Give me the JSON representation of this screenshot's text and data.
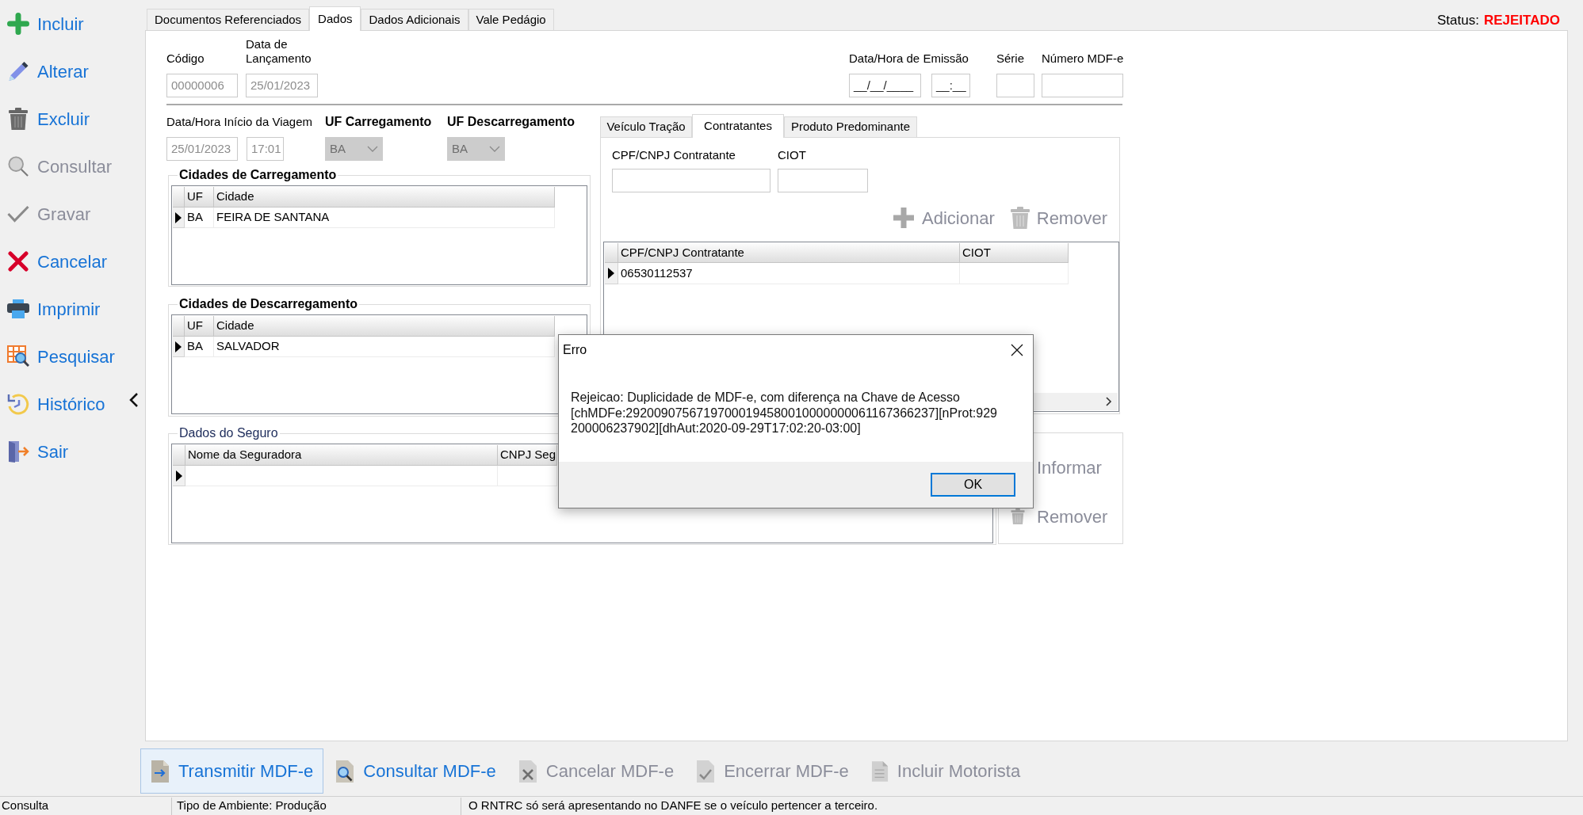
{
  "sidebar": {
    "items": [
      {
        "label": "Incluir",
        "disabled": false
      },
      {
        "label": "Alterar",
        "disabled": false
      },
      {
        "label": "Excluir",
        "disabled": false
      },
      {
        "label": "Consultar",
        "disabled": true
      },
      {
        "label": "Gravar",
        "disabled": true
      },
      {
        "label": "Cancelar",
        "disabled": false
      },
      {
        "label": "Imprimir",
        "disabled": false
      },
      {
        "label": "Pesquisar",
        "disabled": false
      },
      {
        "label": "Histórico",
        "disabled": false
      },
      {
        "label": "Sair",
        "disabled": false
      }
    ]
  },
  "tabs": [
    {
      "label": "Documentos Referenciados",
      "selected": false
    },
    {
      "label": "Dados",
      "selected": true
    },
    {
      "label": "Dados Adicionais",
      "selected": false
    },
    {
      "label": "Vale Pedágio",
      "selected": false
    }
  ],
  "status": {
    "label": "Status:",
    "value": "REJEITADO"
  },
  "codigo": {
    "label": "Código",
    "value": "00000006",
    "disabled": true
  },
  "data_lancamento": {
    "label": "Data de Lançamento",
    "value": "25/01/2023",
    "disabled": true
  },
  "emissao": {
    "label": "Data/Hora de Emissão",
    "date_value": "__/__/____",
    "time_value": "__:__"
  },
  "serie": {
    "label": "Série"
  },
  "numero_mdfe": {
    "label": "Número MDF-e"
  },
  "inicio_viagem": {
    "label": "Data/Hora Início da Viagem",
    "date_value": "25/01/2023",
    "time_value": "17:01",
    "disabled": true
  },
  "uf_carregamento": {
    "label": "UF Carregamento",
    "value": "BA",
    "disabled": true
  },
  "uf_descarregamento": {
    "label": "UF Descarregamento",
    "value": "BA",
    "disabled": true
  },
  "cidades_carregamento": {
    "title": "Cidades de Carregamento",
    "columns": [
      "UF",
      "Cidade"
    ],
    "rows": [
      {
        "current": true,
        "cells": [
          "BA",
          "FEIRA DE SANTANA"
        ]
      }
    ]
  },
  "cidades_descarregamento": {
    "title": "Cidades de Descarregamento",
    "columns": [
      "UF",
      "Cidade"
    ],
    "rows": [
      {
        "current": true,
        "cells": [
          "BA",
          "SALVADOR"
        ]
      }
    ]
  },
  "veiculo_tabs": [
    {
      "label": "Veículo Tração",
      "selected": false
    },
    {
      "label": "Contratantes",
      "selected": true
    },
    {
      "label": "Produto Predominante",
      "selected": false
    }
  ],
  "contratantes": {
    "fields": [
      {
        "label": "CPF/CNPJ Contratante"
      },
      {
        "label": "CIOT"
      }
    ],
    "actions": [
      {
        "label": "Adicionar",
        "disabled": true
      },
      {
        "label": "Remover",
        "disabled": true
      }
    ],
    "columns": [
      "CPF/CNPJ Contratante",
      "CIOT"
    ],
    "rows": [
      {
        "current": true,
        "cells": [
          "06530112537"
        ]
      }
    ]
  },
  "seguro": {
    "title": "Dados do Seguro",
    "columns": [
      "Nome da Seguradora",
      "CNPJ Seg"
    ],
    "rows": [
      {
        "current": true
      }
    ],
    "actions": [
      {
        "label": "Informar",
        "disabled": true
      },
      {
        "label": "Remover",
        "disabled": true
      }
    ]
  },
  "bottom_actions": [
    {
      "label": "Transmitir MDF-e",
      "disabled": false,
      "highlighted": true
    },
    {
      "label": "Consultar MDF-e",
      "disabled": false,
      "highlighted": false
    },
    {
      "label": "Cancelar MDF-e",
      "disabled": true,
      "highlighted": false
    },
    {
      "label": "Encerrar MDF-e",
      "disabled": true,
      "highlighted": false
    },
    {
      "label": "Incluir Motorista",
      "disabled": true,
      "highlighted": false
    }
  ],
  "status_bar": [
    "Consulta",
    "Tipo de Ambiente: Produção",
    "O RNTRC só será apresentando no DANFE se o veículo pertencer a terceiro."
  ],
  "dialog": {
    "title": "Erro",
    "message": "Rejeicao: Duplicidade de MDF-e, com diferença na Chave de Acesso",
    "details": "[chMDFe:29200907567197000194580010000000061167366237][nProt:929200006237902][dhAut:2020-09-29T17:02:20-03:00]",
    "buttons": [
      {
        "label": "OK",
        "default": true
      }
    ]
  }
}
